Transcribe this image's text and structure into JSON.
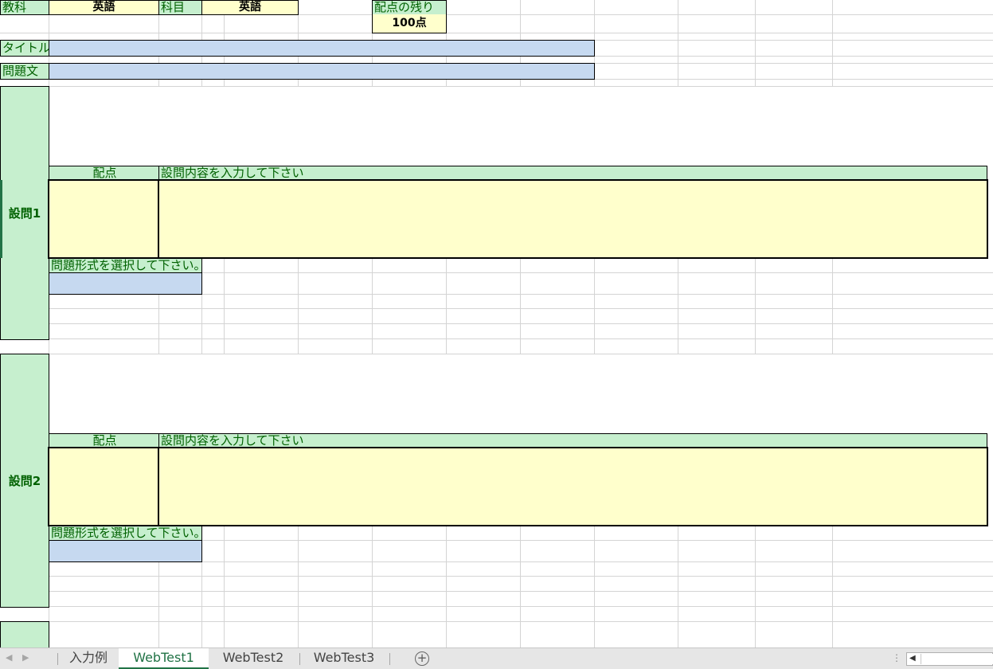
{
  "header": {
    "kyouka_label": "教科",
    "kyouka_value": "英語",
    "kamoku_label": "科目",
    "kamoku_value": "英語",
    "remaining_label": "配点の残り",
    "remaining_value": "100点"
  },
  "fields": {
    "title_label": "タイトル",
    "mondaibun_label": "問題文"
  },
  "questions": [
    {
      "label": "設問1",
      "points_header": "配点",
      "content_header": "設問内容を入力して下さい",
      "format_header": "問題形式を選択して下さい。"
    },
    {
      "label": "設問2",
      "points_header": "配点",
      "content_header": "設問内容を入力して下さい",
      "format_header": "問題形式を選択して下さい。"
    }
  ],
  "tabs": [
    {
      "label": "入力例",
      "active": false
    },
    {
      "label": "WebTest1",
      "active": true
    },
    {
      "label": "WebTest2",
      "active": false
    },
    {
      "label": "WebTest3",
      "active": false
    }
  ],
  "icons": {
    "prev_sheet": "triangle-left",
    "next_sheet": "triangle-right",
    "add_sheet": "plus-circle",
    "scroll_left": "triangle-left"
  },
  "colors": {
    "label_fill": "#c6efce",
    "label_text": "#006100",
    "input_fill": "#ffffcc",
    "select_fill": "#c6d9f0",
    "active_tab": "#217346"
  }
}
